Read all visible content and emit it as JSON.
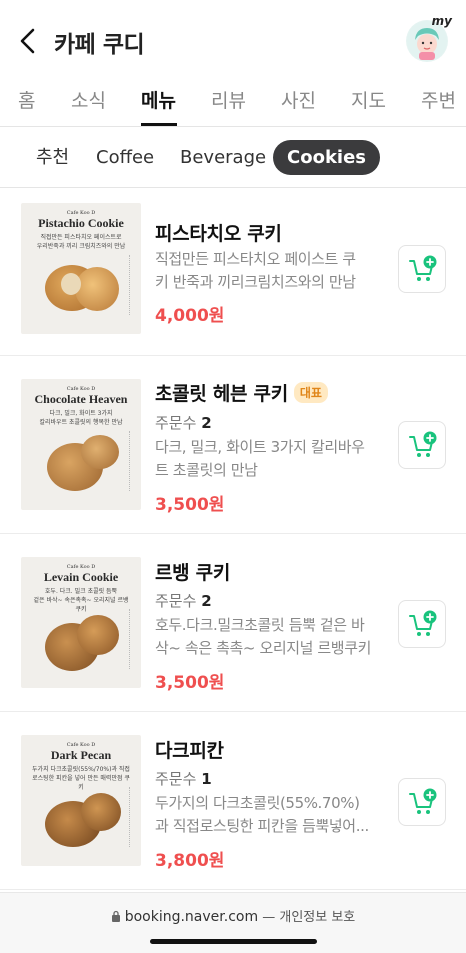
{
  "header": {
    "title": "카페 쿠디",
    "avatar_label": "my"
  },
  "main_tabs": [
    {
      "label": "홈",
      "active": false
    },
    {
      "label": "소식",
      "active": false
    },
    {
      "label": "메뉴",
      "active": true
    },
    {
      "label": "리뷰",
      "active": false
    },
    {
      "label": "사진",
      "active": false
    },
    {
      "label": "지도",
      "active": false
    },
    {
      "label": "주변",
      "active": false
    }
  ],
  "sub_tabs": [
    {
      "label": "추천",
      "active": false
    },
    {
      "label": "Coffee",
      "active": false
    },
    {
      "label": "Beverage",
      "active": false
    },
    {
      "label": "Cookies",
      "active": true
    }
  ],
  "menu_items": [
    {
      "name": "피스타치오 쿠키",
      "badge": "",
      "orders_label": "",
      "orders_count": "",
      "desc_line1": "직접만든 피스타치오 페이스트 쿠",
      "desc_line2": "키 반죽과 끼리크림치즈와의 만남",
      "price": "4,000원",
      "thumb": {
        "brand": "Cafe Koo D",
        "title": "Pistachio Cookie",
        "desc_line1": "직접만든 피스타치오 페이스트로",
        "desc_line2": "우리반죽과 끼리 크림치즈와의 만남"
      }
    },
    {
      "name": "초콜릿 헤븐 쿠키",
      "badge": "대표",
      "orders_label": "주문수",
      "orders_count": "2",
      "desc_line1": "다크, 밀크, 화이트 3가지 칼리바우",
      "desc_line2": "트 초콜릿의 만남",
      "price": "3,500원",
      "thumb": {
        "brand": "Cafe Koo D",
        "title": "Chocolate Heaven",
        "desc_line1": "다크, 밀크, 화이트 3가지",
        "desc_line2": "칼리바우트 초콜릿의 행복한 만남"
      }
    },
    {
      "name": "르뱅 쿠키",
      "badge": "",
      "orders_label": "주문수",
      "orders_count": "2",
      "desc_line1": "호두.다크.밀크초콜릿 듬뿍 겉은 바",
      "desc_line2": "삭~ 속은 촉촉~ 오리지널 르뱅쿠키",
      "price": "3,500원",
      "thumb": {
        "brand": "Cafe Koo D",
        "title": "Levain Cookie",
        "desc_line1": "호두. 다크. 밀크 초콜릿 듬뿍",
        "desc_line2": "겉은 바삭~ 속은촉촉~ 오리지널 르뱅쿠키"
      }
    },
    {
      "name": "다크피칸",
      "badge": "",
      "orders_label": "주문수",
      "orders_count": "1",
      "desc_line1": "두가지의 다크초콜릿(55%.70%)",
      "desc_line2": "과 직접로스팅한 피칸을 듬뿍넣어...",
      "price": "3,800원",
      "thumb": {
        "brand": "Cafe Koo D",
        "title": "Dark Pecan",
        "desc_line1": "두가지 다크초콜릿(55%/70%)과 직접",
        "desc_line2": "로스팅한 피칸을 넣어 만든 매력만점 쿠키"
      }
    }
  ],
  "footer": {
    "url": "booking.naver.com",
    "separator": " — ",
    "privacy": "개인정보 보호"
  },
  "colors": {
    "price": "#ef4f4f",
    "cart_icon": "#19c37d",
    "active_chip": "#3b3b3d",
    "badge_bg": "#ffe9c2",
    "badge_text": "#e0861a"
  }
}
